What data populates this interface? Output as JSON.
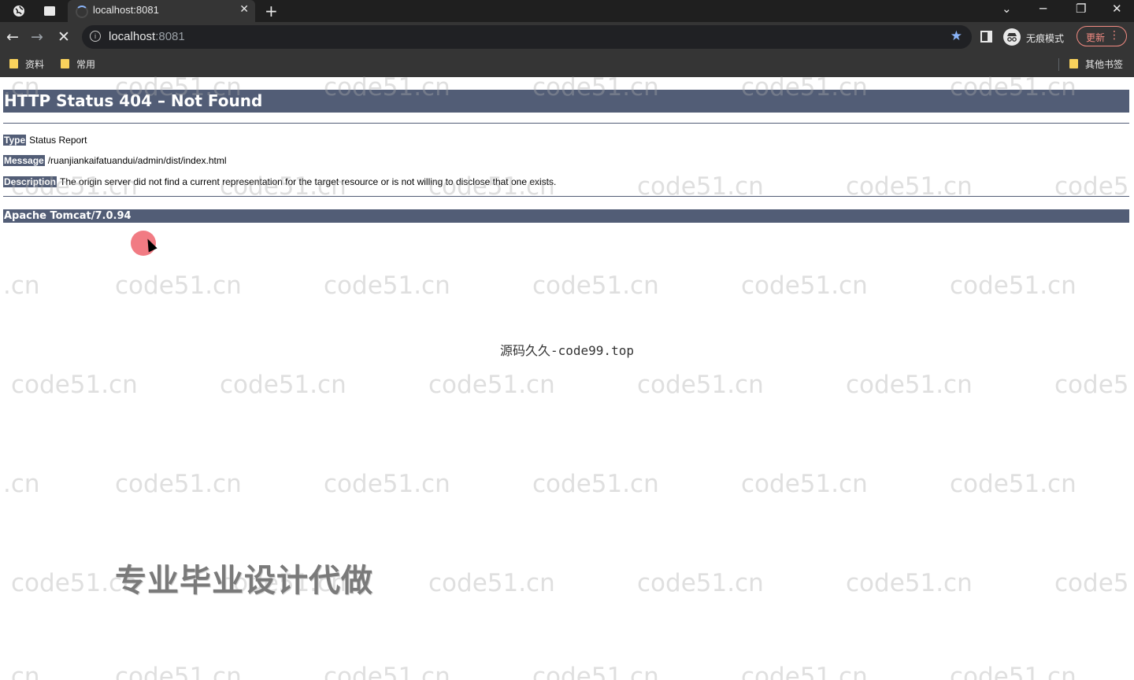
{
  "browser": {
    "tab_title": "localhost:8081",
    "tab_close": "✕",
    "new_tab": "+",
    "window_controls": {
      "collapse": "⌄",
      "minimize": "─",
      "restore": "❐",
      "close": "✕"
    },
    "nav": {
      "back": "←",
      "forward": "→",
      "stop": "✕"
    },
    "url_host": "localhost",
    "url_port": ":8081",
    "bookmark_star": "★",
    "incognito_label": "无痕模式",
    "update_label": "更新",
    "menu": "⋮",
    "bookmarks": [
      "资料",
      "常用"
    ],
    "other_bookmarks": "其他书签"
  },
  "page": {
    "heading": "HTTP Status 404 – Not Found",
    "rows": [
      {
        "key": "Type",
        "value": "Status Report"
      },
      {
        "key": "Message",
        "value": "/ruanjiankaifatuandui/admin/dist/index.html"
      },
      {
        "key": "Description",
        "value": "The origin server did not find a current representation for the target resource or is not willing to disclose that one exists."
      }
    ],
    "footer": "Apache Tomcat/7.0.94"
  },
  "overlay": {
    "watermark_text": "code51.cn",
    "watermark_short": ".cn",
    "watermark_cut": "code5",
    "center_watermark": "源码久久-code99.top",
    "promo_text": "专业毕业设计代做"
  },
  "colors": {
    "tomcat_bar": "#525d76",
    "chrome_dark": "#1f1f1f",
    "chrome_toolbar": "#353535",
    "accent_blue": "#8ab4f8",
    "update_red": "#f28b82"
  }
}
